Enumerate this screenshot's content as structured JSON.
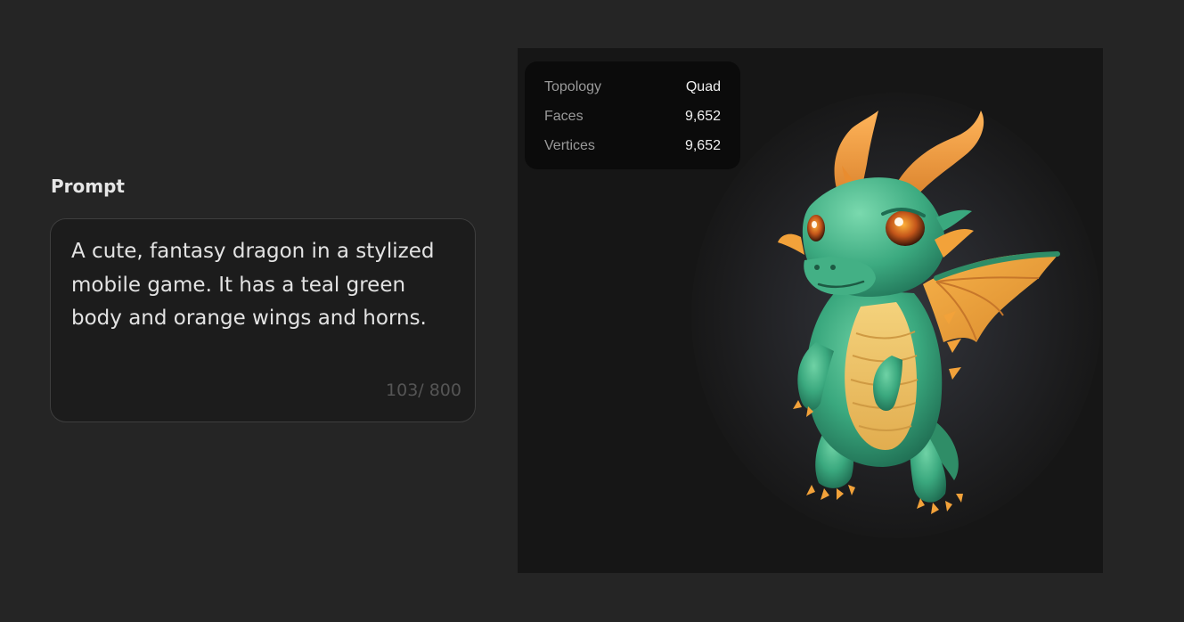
{
  "prompt": {
    "label": "Prompt",
    "text": "A cute, fantasy dragon in a stylized mobile game. It has a teal green body and orange wings and horns.",
    "char_count": "103/ 800"
  },
  "preview": {
    "image_subject": "dragon-model",
    "stats": [
      {
        "label": "Topology",
        "value": "Quad"
      },
      {
        "label": "Faces",
        "value": "9,652"
      },
      {
        "label": "Vertices",
        "value": "9,652"
      }
    ]
  },
  "colors": {
    "background": "#252525",
    "panel": "#161616",
    "card": "#0b0b0b",
    "dragon_body": "#3fae82",
    "dragon_accent": "#f2a23a",
    "dragon_belly": "#efc86a"
  }
}
